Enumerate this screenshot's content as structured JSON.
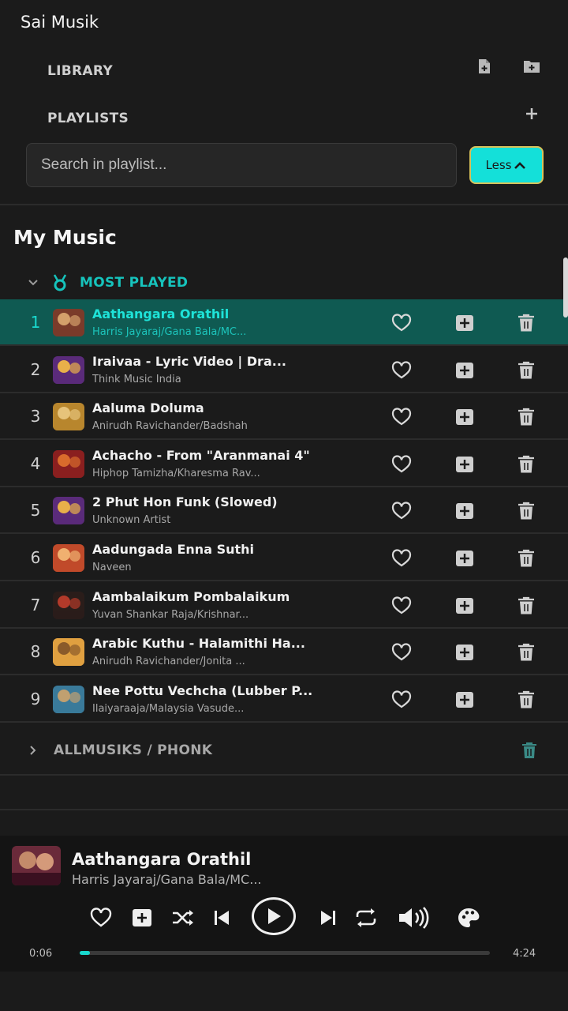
{
  "app": {
    "title": "Sai Musik"
  },
  "sidebar": {
    "library_label": "LIBRARY",
    "playlists_label": "PLAYLISTS",
    "search_placeholder": "Search in playlist...",
    "less_label": "Less"
  },
  "main": {
    "title": "My Music",
    "most_played_label": "MOST PLAYED",
    "tracks": [
      {
        "num": "1",
        "title": "Aathangara Orathil",
        "artist": "Harris Jayaraj/Gana Bala/MC...",
        "thumb": [
          "#7a3b2a",
          "#d4a06b"
        ]
      },
      {
        "num": "2",
        "title": "Iraivaa - Lyric Video | Dra...",
        "artist": "Think Music India",
        "thumb": [
          "#5a2b7a",
          "#e8b04a"
        ]
      },
      {
        "num": "3",
        "title": "Aaluma Doluma",
        "artist": "Anirudh Ravichander/Badshah",
        "thumb": [
          "#b8862d",
          "#e6c37a"
        ]
      },
      {
        "num": "4",
        "title": "Achacho - From \"Aranmanai 4\"",
        "artist": "Hiphop Tamizha/Kharesma Rav...",
        "thumb": [
          "#8a1f1f",
          "#d96b2c"
        ]
      },
      {
        "num": "5",
        "title": "2 Phut Hon Funk (Slowed)",
        "artist": "Unknown Artist",
        "thumb": [
          "#5a2b7a",
          "#e8b04a"
        ]
      },
      {
        "num": "6",
        "title": "Aadungada Enna Suthi",
        "artist": "Naveen",
        "thumb": [
          "#c04a2a",
          "#f0b070"
        ]
      },
      {
        "num": "7",
        "title": "Aambalaikum Pombalaikum",
        "artist": "Yuvan Shankar Raja/Krishnar...",
        "thumb": [
          "#2a1d1a",
          "#b33a2a"
        ]
      },
      {
        "num": "8",
        "title": "Arabic Kuthu - Halamithi Ha...",
        "artist": "Anirudh Ravichander/Jonita ...",
        "thumb": [
          "#e0a040",
          "#8a5a2a"
        ]
      },
      {
        "num": "9",
        "title": "Nee Pottu Vechcha (Lubber P...",
        "artist": "Ilaiyaraaja/Malaysia Vasude...",
        "thumb": [
          "#3a7a9a",
          "#c0a070"
        ]
      }
    ],
    "allmusik_label": "ALLMUSIKS / PHONK"
  },
  "player": {
    "title": "Aathangara Orathil",
    "artist": "Harris Jayaraj/Gana Bala/MC...",
    "current_time": "0:06",
    "duration": "4:24",
    "progress": 0.025
  },
  "colors": {
    "accent": "#14e0d9",
    "active_row": "#0f5a52",
    "background": "#1b1b1b"
  },
  "icons": {
    "library_actions": [
      "add-file-icon",
      "add-folder-icon"
    ],
    "playlist_action": "plus-icon",
    "track_actions": [
      "heart-icon",
      "add-to-playlist-icon",
      "trash-icon"
    ],
    "player_controls": [
      "heart-icon",
      "add-to-playlist-icon",
      "shuffle-icon",
      "previous-icon",
      "play-icon",
      "next-icon",
      "repeat-icon",
      "volume-icon",
      "palette-icon"
    ]
  }
}
